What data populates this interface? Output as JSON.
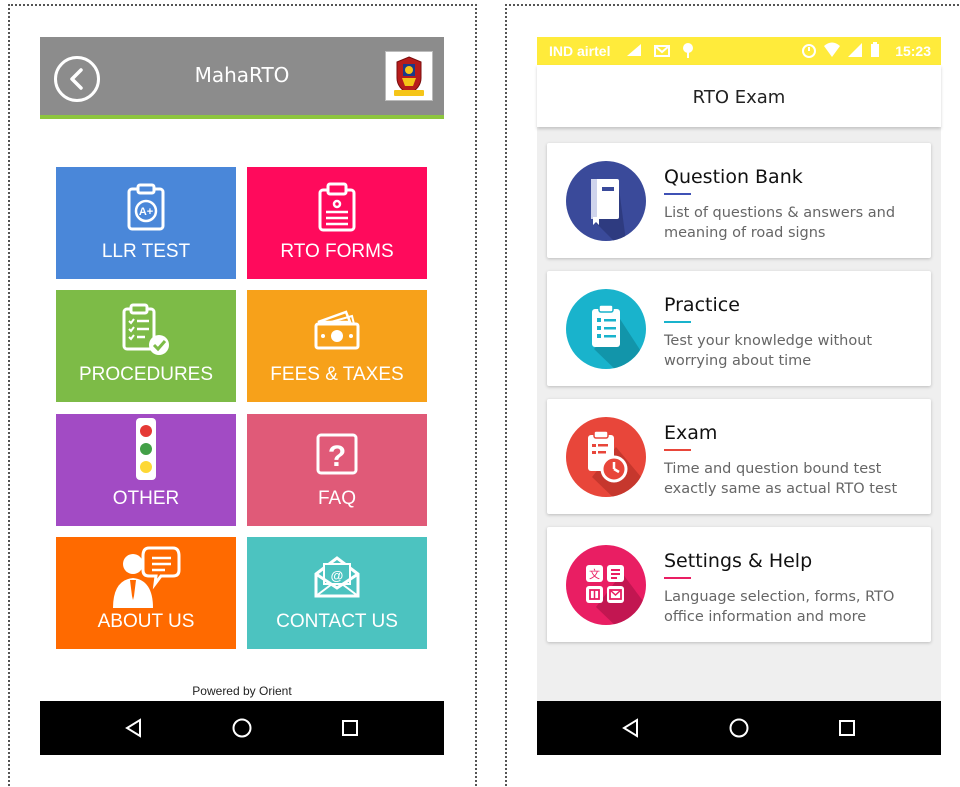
{
  "left_app": {
    "title": "MahaRTO",
    "tiles": [
      {
        "label": "LLR TEST",
        "color": "#4a87d9",
        "icon": "clipboard-aplus-icon"
      },
      {
        "label": "RTO FORMS",
        "color": "#ff0a5c",
        "icon": "forms-clipboard-icon"
      },
      {
        "label": "PROCEDURES",
        "color": "#7dbb47",
        "icon": "checklist-icon"
      },
      {
        "label": "FEES & TAXES",
        "color": "#f7a11a",
        "icon": "money-icon"
      },
      {
        "label": "OTHER",
        "color": "#a24bc4",
        "icon": "traffic-light-icon"
      },
      {
        "label": "FAQ",
        "color": "#e05a78",
        "icon": "question-icon"
      },
      {
        "label": "ABOUT US",
        "color": "#ff6a00",
        "icon": "person-speech-icon"
      },
      {
        "label": "CONTACT US",
        "color": "#4cc3c0",
        "icon": "email-envelope-icon"
      }
    ],
    "footer": "Powered by Orient"
  },
  "right_app": {
    "status_bar": {
      "carrier": "IND airtel",
      "time": "15:23"
    },
    "title": "RTO Exam",
    "cards": [
      {
        "title": "Question Bank",
        "description": "List of questions & answers and meaning of road signs",
        "circle_color": "#3a4a9a",
        "accent": "#3f51b5",
        "icon": "book-icon"
      },
      {
        "title": "Practice",
        "description": "Test your knowledge without worrying about time",
        "circle_color": "#19b3cc",
        "accent": "#19b3cc",
        "icon": "clipboard-list-icon"
      },
      {
        "title": "Exam",
        "description": "Time and question bound test exactly same as actual RTO test",
        "circle_color": "#e8463a",
        "accent": "#e8463a",
        "icon": "clipboard-clock-icon"
      },
      {
        "title": "Settings & Help",
        "description": "Language selection, forms, RTO office information and more",
        "circle_color": "#e91e63",
        "accent": "#e91e63",
        "icon": "settings-grid-icon"
      }
    ]
  }
}
